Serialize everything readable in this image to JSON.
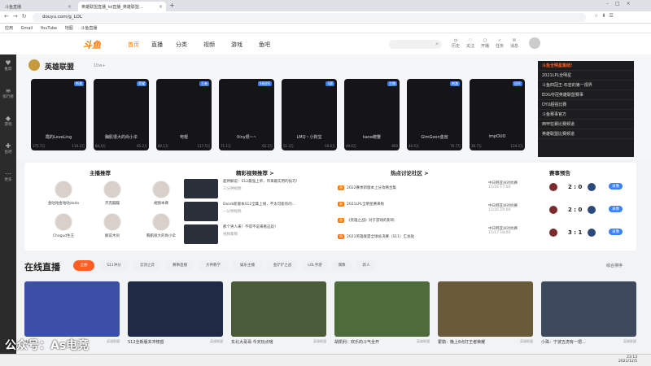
{
  "browser": {
    "tabs": [
      "斗鱼直播",
      "英雄联盟直播_lol直播_英雄联盟..."
    ],
    "url": "douyu.com/g_LOL",
    "bookmarks": [
      "应用",
      "Gmail",
      "YouTube",
      "地图",
      "斗鱼直播"
    ]
  },
  "header": {
    "logo": "斗鱼",
    "nav": [
      "首页",
      "直播",
      "分类",
      "视频",
      "游戏",
      "鱼吧"
    ],
    "icons": [
      "历史",
      "关注",
      "开播",
      "任务",
      "消息"
    ]
  },
  "sidebar": [
    "推荐",
    "排行榜",
    "游戏",
    "鱼吧",
    "更多"
  ],
  "category": {
    "title": "英雄联盟",
    "count": "10w+"
  },
  "cards": [
    {
      "badge": "刺激",
      "name": "霞的LoveLing",
      "hot": "375.7万",
      "fans": "110.2万"
    },
    {
      "badge": "荣耀",
      "name": "胸肌很大的尚小伞",
      "hot": "84.4万",
      "fans": "65.2万"
    },
    {
      "badge": "王者",
      "name": "电棍",
      "hot": "80.1万",
      "fans": "117.5万"
    },
    {
      "badge": "S8冠军",
      "name": "Xiny很~~",
      "hot": "71.1万",
      "fans": "62.2万"
    },
    {
      "badge": "S赛",
      "name": "LMQ丶小狗宝",
      "hot": "51.3万",
      "fans": "50.6万"
    },
    {
      "badge": "主播",
      "name": "kane螃蟹",
      "hot": "49.0万",
      "fans": "850"
    },
    {
      "badge": "刺激",
      "name": "GimGoon金宫",
      "hot": "40.5万",
      "fans": "76.7万"
    },
    {
      "badge": "冠军",
      "name": "impOUO",
      "hot": "36.7万",
      "fans": "124.2万"
    }
  ],
  "ranking": [
    "斗鱼全明星集结!",
    "2021LPL全明星",
    "斗鱼四冠王-石岩的第一视界",
    "EDG夺冠英雄联盟赛事",
    "DYU超强比赛",
    "斗鱼赛事官方",
    "西甲狂暴比赛频道",
    "英雄联盟比赛频道"
  ],
  "recommend": {
    "title": "主播推荐",
    "anchors": [
      "金咕咕金咕咕dodo",
      "杰克蹦蹦",
      "胡图本尊",
      "Chogud生王",
      "解说木剑",
      "胸肌很大的尚小伞"
    ]
  },
  "videos": {
    "title": "精彩视频推荐 >",
    "items": [
      {
        "title": "超神解说：S12最强上单，带来最实用的技巧！",
        "sub": "三分钟视频"
      },
      {
        "title": "Doinb新版本S12全集上线，不太可能有的…",
        "sub": "一分钟视频"
      },
      {
        "title": "那个男人来！不得不说来看这段！",
        "sub": "视频集锦"
      }
    ]
  },
  "hot": {
    "title": "热点讨论社区 >",
    "items": [
      {
        "tag": "热",
        "text": "2022赛季新版本上分攻略合集"
      },
      {
        "tag": "新",
        "text": "2021LPL全明星赛来啦"
      },
      {
        "tag": "热",
        "text": "《英雄之战》对于游戏的影响"
      },
      {
        "tag": "热",
        "text": "2021英雄联盟全球总决赛（S11）汇总贴"
      }
    ]
  },
  "forecast": {
    "title": "赛事预告",
    "rows": [
      {
        "league": "中日韩亚洲对抗赛",
        "date": "11/16 17:00",
        "score": "2 : 0",
        "btn": "录像"
      },
      {
        "league": "中日韩亚洲对抗赛",
        "date": "11/16 19:00",
        "score": "2 : 0",
        "btn": "录像"
      },
      {
        "league": "中日韩亚洲对抗赛",
        "date": "11/17 18:00",
        "score": "3 : 1",
        "btn": "录像"
      }
    ]
  },
  "live": {
    "title": "在线直播",
    "chips": [
      "全部",
      "S11冲分",
      "云顶之弈",
      "赛事直播",
      "大神教学",
      "娱乐主播",
      "金铲铲之战",
      "LOL手游",
      "偶像",
      "新人"
    ],
    "sort": "综合排序",
    "streams": [
      {
        "title": "小狗宝",
        "hot": "...",
        "tag": "英雄联盟"
      },
      {
        "title": "S12全新版本冲榜首",
        "hot": "83.4万",
        "tag": "英雄联盟"
      },
      {
        "title": "东北大哥哥·今天玩点啥",
        "hot": "...",
        "tag": "英雄联盟"
      },
      {
        "title": "胡凯利：欢乐的斗气全开",
        "hot": "...",
        "tag": "英雄联盟"
      },
      {
        "title": "霍勒：晚上8点打王者荣耀",
        "hot": "...",
        "tag": "英雄联盟"
      },
      {
        "title": "小珠：宁波五虎有一把...",
        "hot": "...",
        "tag": "英雄联盟"
      }
    ]
  },
  "watermark": "公众号：As电竞",
  "clock": {
    "time": "23:13",
    "date": "2021/12/5"
  },
  "colors": {
    "accent": "#ff7700",
    "chip_on": "#ff5d23",
    "sidebar": "#2b2b2b"
  }
}
